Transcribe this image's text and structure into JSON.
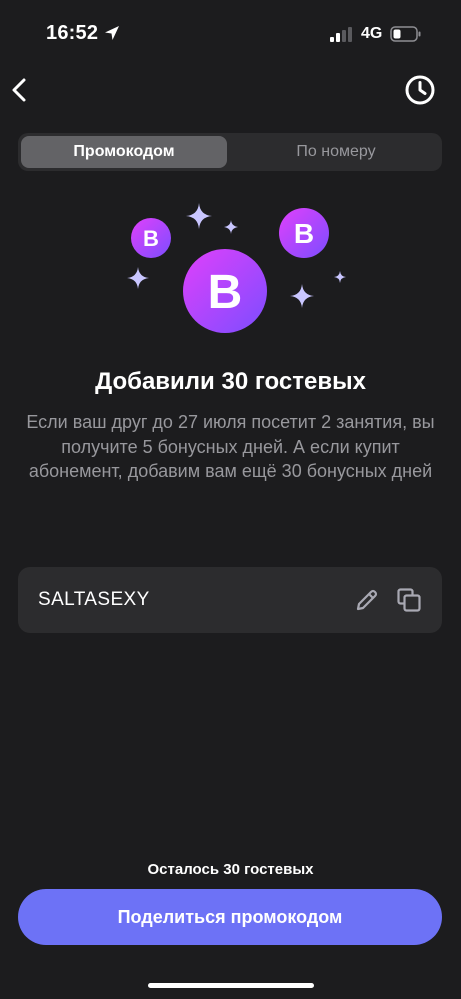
{
  "status_bar": {
    "time": "16:52",
    "network": "4G"
  },
  "segmented_control": {
    "tabs": [
      {
        "label": "Промокодом",
        "active": true
      },
      {
        "label": "По номеру",
        "active": false
      }
    ]
  },
  "hero": {
    "badge_letter": "B",
    "colors": {
      "gradient_start": "#e040fb",
      "gradient_end": "#7c4dff",
      "sparkle": "#c9c6ff"
    }
  },
  "main": {
    "title": "Добавили 30 гостевых",
    "description": "Если ваш друг до 27 июля посетит 2 занятия, вы получите 5 бонусных дней. А если купит абонемент, добавим вам ещё 30 бонусных дней"
  },
  "promo": {
    "code": "SALTASEXY"
  },
  "footer": {
    "remaining": "Осталось 30 гостевых",
    "share_label": "Поделиться промокодом",
    "accent_color": "#6d72f6"
  }
}
